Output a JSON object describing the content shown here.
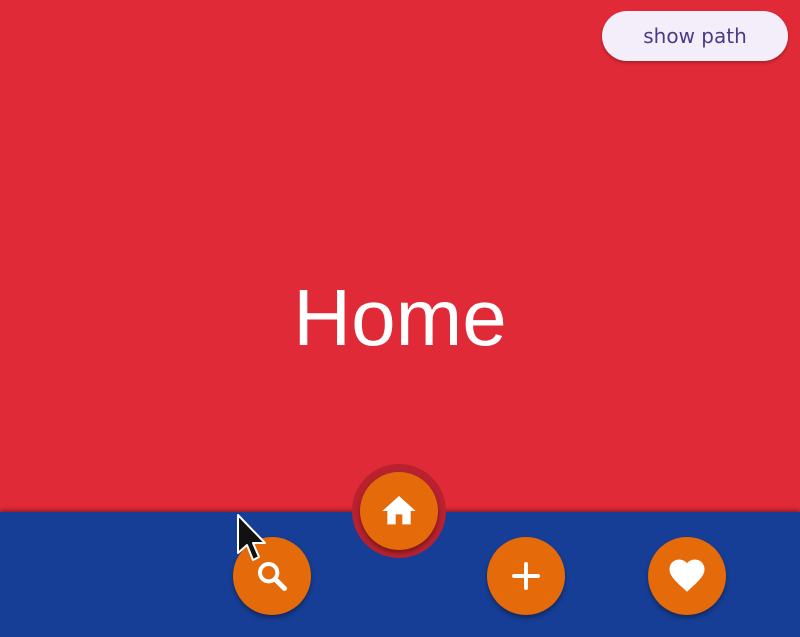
{
  "page": {
    "title": "Home"
  },
  "header": {
    "show_path_label": "show path"
  },
  "bottom_nav": {
    "items": [
      {
        "icon": "search-icon",
        "selected": false
      },
      {
        "icon": "home-icon",
        "selected": true
      },
      {
        "icon": "plus-icon",
        "selected": false
      },
      {
        "icon": "heart-icon",
        "selected": false
      }
    ]
  },
  "colors": {
    "page_background": "#e12a37",
    "bottom_bar": "#173e96",
    "nav_button": "#e56a09",
    "selected_ring": "#b8222e",
    "show_path_button_bg": "#f4eefa",
    "show_path_button_text": "#4d3a86"
  }
}
